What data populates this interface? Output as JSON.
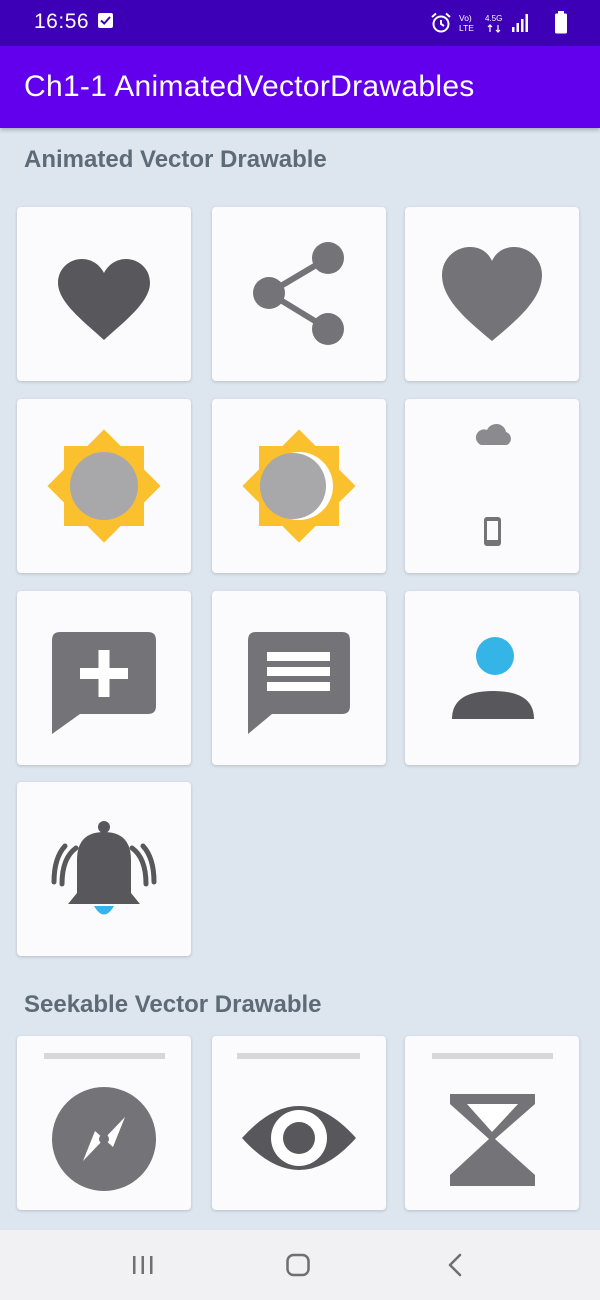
{
  "status_bar": {
    "time": "16:56",
    "icons": [
      "check-icon",
      "alarm-icon",
      "volte-icon",
      "4g-icon",
      "signal-icon",
      "battery-icon"
    ],
    "volte_label": "Vo)\nLTE",
    "network_label": "4.5G"
  },
  "app_bar": {
    "title": "Ch1-1 AnimatedVectorDrawables"
  },
  "sections": {
    "animated": {
      "title": "Animated Vector Drawable",
      "items": [
        "heart-filled-icon",
        "share-icon",
        "heart-large-icon",
        "sun-icon",
        "sun-moon-icon",
        "cloud-phone-icon",
        "add-comment-icon",
        "message-icon",
        "person-icon",
        "bell-ringing-icon"
      ]
    },
    "seekable": {
      "title": "Seekable Vector Drawable",
      "items": [
        "compass-icon",
        "eye-icon",
        "hourglass-icon"
      ],
      "seek_progress": [
        0,
        0,
        0
      ]
    }
  },
  "nav_bar": {
    "buttons": [
      "recent-apps-icon",
      "home-icon",
      "back-icon"
    ]
  },
  "colors": {
    "status_bar": "#3e00b7",
    "app_bar": "#6200ee",
    "background": "#dde6ef",
    "card": "#fbfbfd",
    "icon_dark": "#58585c",
    "icon_gray": "#747478",
    "sun_yellow": "#fbc02d",
    "accent_blue": "#35b4e8",
    "section_title": "#5e6a75"
  }
}
